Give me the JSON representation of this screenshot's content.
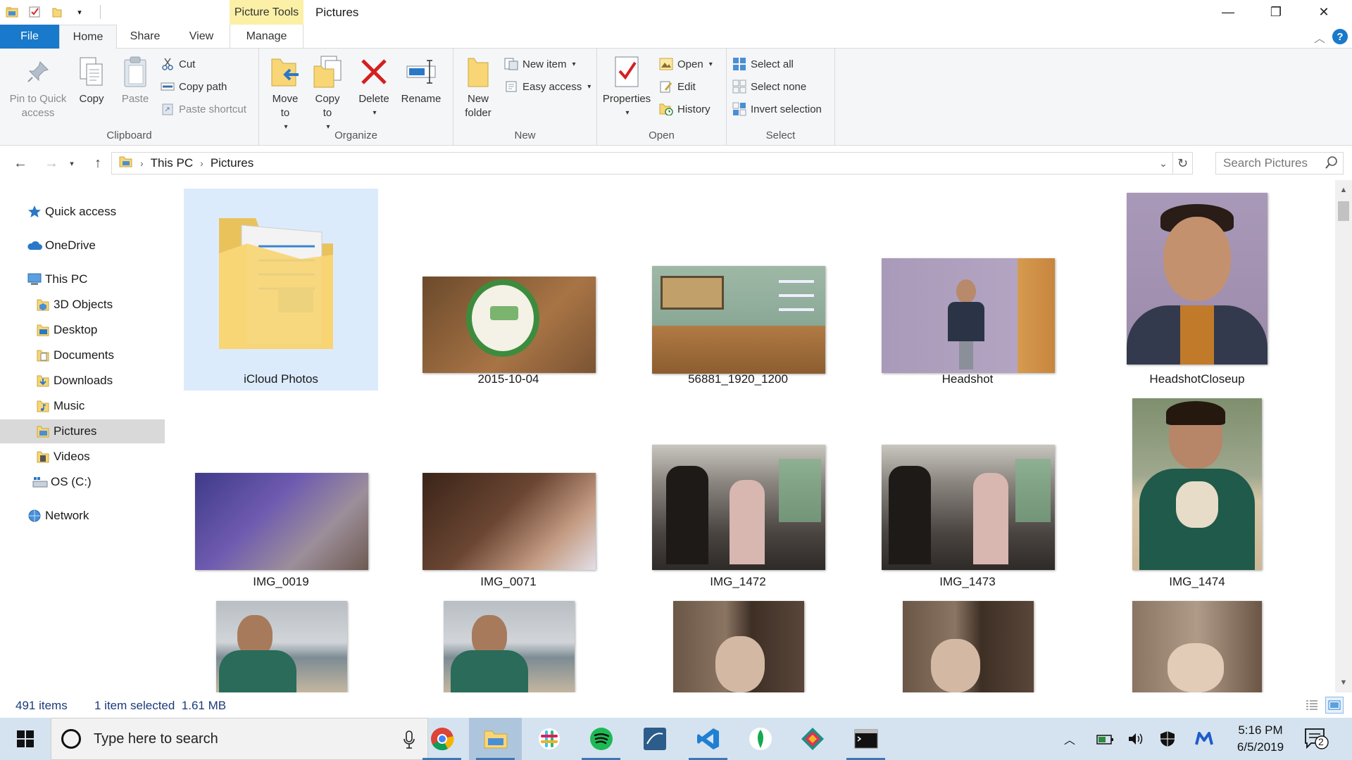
{
  "window": {
    "title": "Pictures",
    "context_tab": "Picture Tools",
    "minimize_glyph": "—",
    "maximize_glyph": "❐",
    "close_glyph": "✕"
  },
  "ribbon_tabs": {
    "file": "File",
    "home": "Home",
    "share": "Share",
    "view": "View",
    "manage": "Manage"
  },
  "clipboard": {
    "pin": "Pin to Quick access",
    "copy": "Copy",
    "paste": "Paste",
    "cut": "Cut",
    "copy_path": "Copy path",
    "paste_shortcut": "Paste shortcut",
    "label": "Clipboard"
  },
  "organize": {
    "move_to": "Move to",
    "copy_to": "Copy to",
    "delete": "Delete",
    "rename": "Rename",
    "label": "Organize"
  },
  "new": {
    "new_folder": "New folder",
    "new_item": "New item",
    "easy_access": "Easy access",
    "label": "New"
  },
  "open": {
    "properties": "Properties",
    "open": "Open",
    "edit": "Edit",
    "history": "History",
    "label": "Open"
  },
  "select": {
    "select_all": "Select all",
    "select_none": "Select none",
    "invert": "Invert selection",
    "label": "Select"
  },
  "address": {
    "crumbs": [
      "This PC",
      "Pictures"
    ],
    "search_placeholder": "Search Pictures"
  },
  "nav": {
    "items": [
      {
        "label": "Quick access",
        "icon": "star-icon"
      },
      {
        "label": "OneDrive",
        "icon": "cloud-icon"
      },
      {
        "label": "This PC",
        "icon": "computer-icon"
      },
      {
        "label": "3D Objects",
        "icon": "cube-folder-icon"
      },
      {
        "label": "Desktop",
        "icon": "desktop-folder-icon"
      },
      {
        "label": "Documents",
        "icon": "documents-folder-icon"
      },
      {
        "label": "Downloads",
        "icon": "downloads-folder-icon"
      },
      {
        "label": "Music",
        "icon": "music-folder-icon"
      },
      {
        "label": "Pictures",
        "icon": "pictures-folder-icon"
      },
      {
        "label": "Videos",
        "icon": "videos-folder-icon"
      },
      {
        "label": "OS (C:)",
        "icon": "drive-icon"
      },
      {
        "label": "Network",
        "icon": "network-icon"
      }
    ],
    "selected": "Pictures"
  },
  "files": [
    {
      "name": "iCloud Photos",
      "kind": "folder"
    },
    {
      "name": "2015-10-04",
      "kind": "image"
    },
    {
      "name": "56881_1920_1200",
      "kind": "image"
    },
    {
      "name": "Headshot",
      "kind": "image"
    },
    {
      "name": "HeadshotCloseup",
      "kind": "image"
    },
    {
      "name": "IMG_0019",
      "kind": "image"
    },
    {
      "name": "IMG_0071",
      "kind": "image"
    },
    {
      "name": "IMG_1472",
      "kind": "image"
    },
    {
      "name": "IMG_1473",
      "kind": "image"
    },
    {
      "name": "IMG_1474",
      "kind": "image"
    },
    {
      "name": "",
      "kind": "image"
    },
    {
      "name": "",
      "kind": "image"
    },
    {
      "name": "",
      "kind": "image"
    },
    {
      "name": "",
      "kind": "image"
    },
    {
      "name": "",
      "kind": "image"
    }
  ],
  "status": {
    "count": "491 items",
    "selection": "1 item selected  1.61 MB"
  },
  "taskbar": {
    "search_placeholder": "Type here to search",
    "apps": [
      "chrome-icon",
      "file-explorer-icon",
      "slack-icon",
      "spotify-icon",
      "mysql-workbench-icon",
      "vscode-icon",
      "mongodb-compass-icon",
      "gitkraken-icon",
      "terminal-icon"
    ],
    "time": "5:16 PM",
    "date": "6/5/2019",
    "notification_count": "2"
  },
  "colors": {
    "accent": "#1979ca",
    "ribbon_bg": "#f5f6f7",
    "context_tab": "#fbf0a6",
    "selection_bg": "#dcebfc",
    "nav_selected": "#d9d9d9",
    "taskbar_bg": "#d5e3f0",
    "folder_yellow": "#f8d675"
  }
}
